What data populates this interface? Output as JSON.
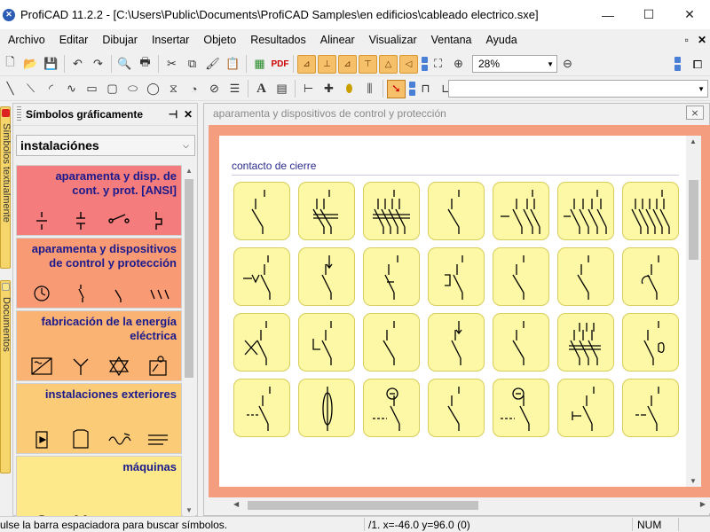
{
  "window": {
    "title": "ProfiCAD 11.2.2 - [C:\\Users\\Public\\Documents\\ProfiCAD Samples\\en edificios\\cableado electrico.sxe]",
    "minimize": "—",
    "maximize": "☐",
    "close": "✕"
  },
  "menu": {
    "items": [
      "Archivo",
      "Editar",
      "Dibujar",
      "Insertar",
      "Objeto",
      "Resultados",
      "Alinear",
      "Visualizar",
      "Ventana",
      "Ayuda"
    ],
    "mdi_restore": "▫",
    "mdi_close": "✕"
  },
  "toolbar": {
    "zoom_value": "28%",
    "pdf_label": "PDF",
    "text_tool": "A"
  },
  "side_tabs": {
    "symbols_tab": "Símbolos textualmente",
    "documents_tab": "Documentos"
  },
  "panel": {
    "title": "Símbolos gráficamente",
    "pin": "⊣",
    "close": "✕",
    "combo_value": "instalaciónes",
    "categories": [
      {
        "title": "aparamenta y disp. de cont. y prot. [ANSI]",
        "color": "#f47c7c"
      },
      {
        "title": "aparamenta y dispositivos de control y protección",
        "color": "#f89a74"
      },
      {
        "title": "fabricación de la energía eléctrica",
        "color": "#fbb374"
      },
      {
        "title": "instalaciones exteriores",
        "color": "#fccb78"
      },
      {
        "title": "máquinas",
        "color": "#fde98a"
      }
    ]
  },
  "document": {
    "title": "aparamenta y dispositivos de control y protección",
    "close": "⨯",
    "section_title": "contacto de cierre"
  },
  "status": {
    "hint": "ulse la barra espaciadora para buscar símbolos.",
    "coords": "/1.  x=-46.0  y=96.0 (0)",
    "num": "NUM"
  }
}
